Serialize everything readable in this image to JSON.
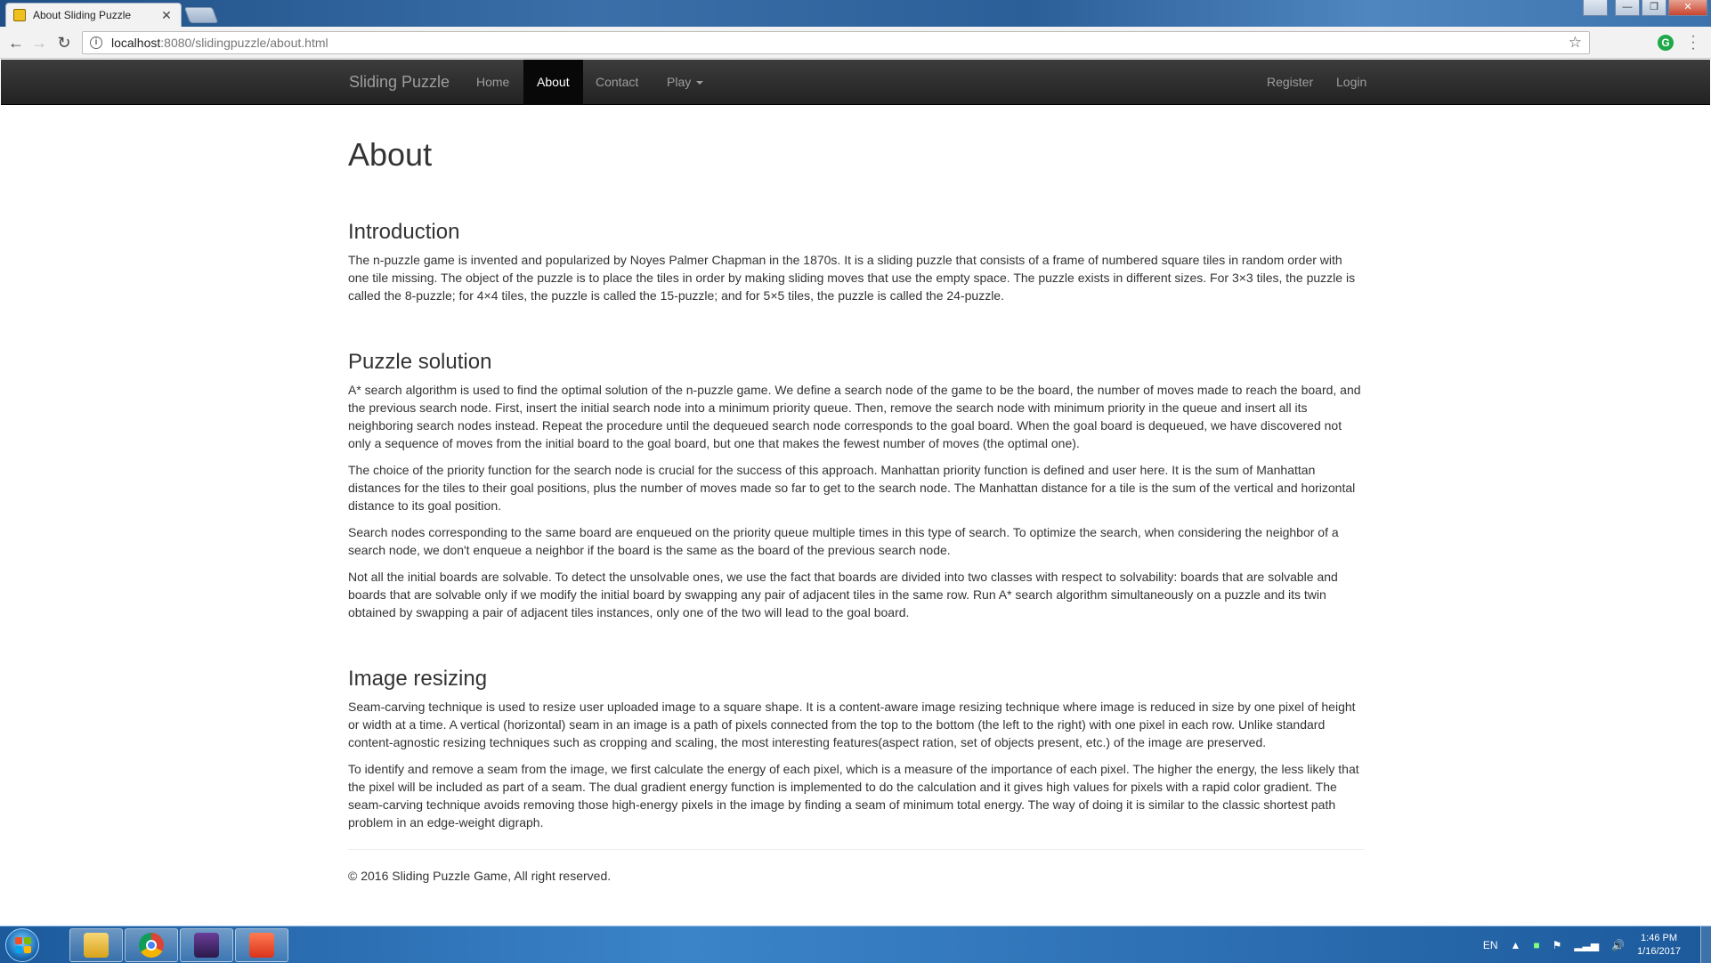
{
  "browser": {
    "tab_title": "About Sliding Puzzle",
    "tab_close": "✕",
    "url_host": "localhost",
    "url_rest": ":8080/slidingpuzzle/about.html",
    "ext_letter": "G"
  },
  "navbar": {
    "brand": "Sliding Puzzle",
    "home": "Home",
    "about": "About",
    "contact": "Contact",
    "play": "Play",
    "register": "Register",
    "login": "Login"
  },
  "page": {
    "title": "About",
    "intro": {
      "heading": "Introduction",
      "p1": "The n-puzzle game is invented and popularized by Noyes Palmer Chapman in the 1870s. It is a sliding puzzle that consists of a frame of numbered square tiles in random order with one tile missing. The object of the puzzle is to place the tiles in order by making sliding moves that use the empty space. The puzzle exists in different sizes. For 3×3 tiles, the puzzle is called the 8-puzzle; for 4×4 tiles, the puzzle is called the 15-puzzle; and for 5×5 tiles, the puzzle is called the 24-puzzle."
    },
    "solution": {
      "heading": "Puzzle solution",
      "p1": "A* search algorithm is used to find the optimal solution of the n-puzzle game. We define a search node of the game to be the board, the number of moves made to reach the board, and the previous search node. First, insert the initial search node into a minimum priority queue. Then, remove the search node with minimum priority in the queue and insert all its neighboring search nodes instead. Repeat the procedure until the dequeued search node corresponds to the goal board. When the goal board is dequeued, we have discovered not only a sequence of moves from the initial board to the goal board, but one that makes the fewest number of moves (the optimal one).",
      "p2": "The choice of the priority function for the search node is crucial for the success of this approach. Manhattan priority function is defined and user here. It is the sum of Manhattan distances for the tiles to their goal positions, plus the number of moves made so far to get to the search node. The Manhattan distance for a tile is the sum of the vertical and horizontal distance to its goal position.",
      "p3": "Search nodes corresponding to the same board are enqueued on the priority queue multiple times in this type of search. To optimize the search, when considering the neighbor of a search node, we don't enqueue a neighbor if the board is the same as the board of the previous search node.",
      "p4": "Not all the initial boards are solvable. To detect the unsolvable ones, we use the fact that boards are divided into two classes with respect to solvability: boards that are solvable and boards that are solvable only if we modify the initial board by swapping any pair of adjacent tiles in the same row. Run A* search algorithm simultaneously on a puzzle and its twin obtained by swapping a pair of adjacent tiles instances, only one of the two will lead to the goal board."
    },
    "resizing": {
      "heading": "Image resizing",
      "p1": "Seam-carving technique is used to resize user uploaded image to a square shape. It is a content-aware image resizing technique where image is reduced in size by one pixel of height or width at a time. A vertical (horizontal) seam in an image is a path of pixels connected from the top to the bottom (the left to the right) with one pixel in each row. Unlike standard content-agnostic resizing techniques such as cropping and scaling, the most interesting features(aspect ration, set of objects present, etc.) of the image are preserved.",
      "p2": "To identify and remove a seam from the image, we first calculate the energy of each pixel, which is a measure of the importance of each pixel. The higher the energy, the less likely that the pixel will be included as part of a seam. The dual gradient energy function is implemented to do the calculation and it gives high values for pixels with a rapid color gradient. The seam-carving technique avoids removing those high-energy pixels in the image by finding a seam of minimum total energy. The way of doing it is similar to the classic shortest path problem in an edge-weight digraph."
    },
    "footer": "© 2016 Sliding Puzzle Game, All right reserved."
  },
  "taskbar": {
    "language": "EN",
    "time": "1:46 PM",
    "date": "1/16/2017"
  },
  "colors": {
    "navbar_bg": "#222222",
    "nav_link": "#9d9d9d",
    "nav_active_bg": "#080808",
    "text": "#333333"
  }
}
